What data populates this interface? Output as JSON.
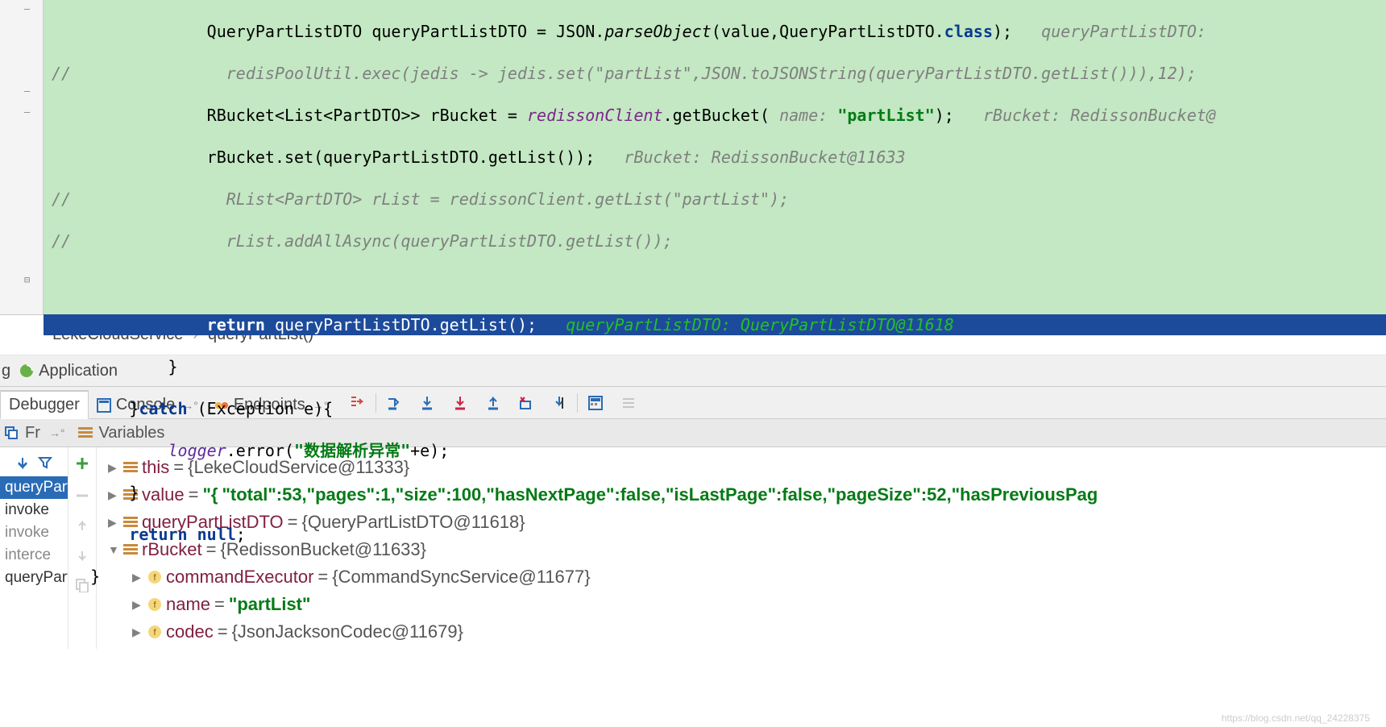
{
  "code": {
    "l1": "                QueryPartListDTO queryPartListDTO = JSON.",
    "l1b": "parseObject",
    "l1c": "(value,QueryPartListDTO.",
    "l1d": "class",
    "l1e": ");   ",
    "l1h": "queryPartListDTO:",
    "l2": "//                redisPoolUtil.exec(jedis -> jedis.set(\"partList\",JSON.toJSONString(queryPartListDTO.getList())),12);",
    "l3a": "                RBucket<List<PartDTO>> rBucket = ",
    "l3b": "redissonClient",
    "l3c": ".getBucket(",
    "l3d": " name: ",
    "l3e": "\"partList\"",
    "l3f": ");   ",
    "l3h": "rBucket: RedissonBucket@",
    "l4a": "                rBucket.set(queryPartListDTO.getList());   ",
    "l4h": "rBucket: RedissonBucket@11633",
    "l5": "//                RList<PartDTO> rList = redissonClient.getList(\"partList\");",
    "l6": "//                rList.addAllAsync(queryPartListDTO.getList());",
    "l7a": "                ",
    "l7b": "return",
    "l7c": " queryPartListDTO.getList();   ",
    "l7h": "queryPartListDTO: QueryPartListDTO@11618",
    "l8": "            }",
    "l9a": "        }",
    "l9b": "catch",
    "l9c": " (Exception e){",
    "l10a": "            ",
    "l10b": "logger",
    "l10c": ".error(",
    "l10d": "\"数据解析异常\"",
    "l10e": "+e);",
    "l11": "        }",
    "l12a": "        ",
    "l12b": "return null",
    "l12c": ";",
    "l13": "    }"
  },
  "breadcrumb": {
    "a": "LekeCloudService",
    "b": "queryPartList()"
  },
  "run": {
    "label": "Application",
    "prefix": "g"
  },
  "tabs": {
    "debugger": "Debugger",
    "console": "Console",
    "endpoints": "Endpoints"
  },
  "varsHeader": {
    "frames": "Fr",
    "variables": "Variables"
  },
  "frames": {
    "sel": "queryPartList",
    "f1": "invoke",
    "f2": "invoke",
    "f3": "interce",
    "f4": "queryPartList"
  },
  "vars": {
    "this": {
      "name": "this",
      "val": "{LekeCloudService@11333}"
    },
    "value": {
      "name": "value",
      "pre": "\"{",
      "json": "\"total\":53,\"pages\":1,\"size\":100,\"hasNextPage\":false,\"isLastPage\":false,\"pageSize\":52,\"hasPreviousPag"
    },
    "qpl": {
      "name": "queryPartListDTO",
      "val": "{QueryPartListDTO@11618}"
    },
    "rb": {
      "name": "rBucket",
      "val": "{RedissonBucket@11633}"
    },
    "ce": {
      "name": "commandExecutor",
      "val": "{CommandSyncService@11677}"
    },
    "nm": {
      "name": "name",
      "val": "\"partList\""
    },
    "cd": {
      "name": "codec",
      "val": "{JsonJacksonCodec@11679}"
    }
  },
  "watermark": "https://blog.csdn.net/qq_24228375"
}
